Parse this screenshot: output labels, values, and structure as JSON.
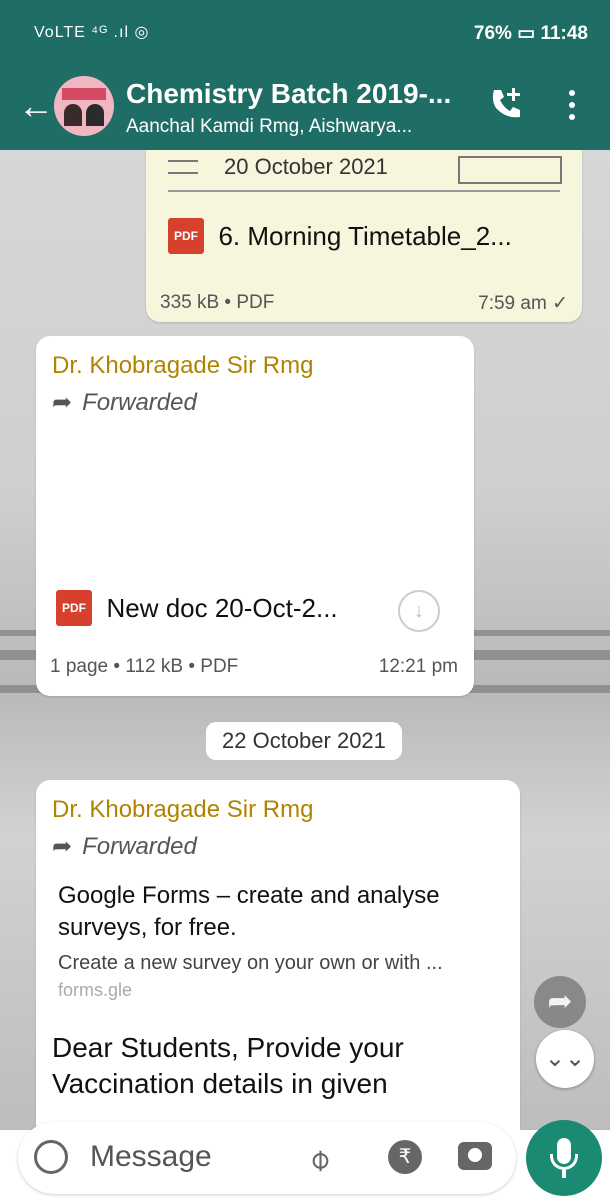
{
  "status_bar": {
    "left_icons": "VoLTE ⁴ᴳ .ıl ◎",
    "battery": "76%",
    "time": "11:48"
  },
  "header": {
    "title": "Chemistry Batch 2019-...",
    "subtitle": "Aanchal Kamdi Rmg, Aishwarya...",
    "brand_color": "#1f6e66"
  },
  "messages": [
    {
      "type": "document_out",
      "date_overlay": "20 October 2021",
      "file_name": "6. Morning Timetable_2...",
      "meta": "335 kB • PDF",
      "time": "7:59 am",
      "status": "✓"
    },
    {
      "type": "document_in",
      "sender": "Dr. Khobragade Sir Rmg",
      "forwarded": "Forwarded",
      "file_name": "New doc 20-Oct-2...",
      "meta": "1 page • 112 kB • PDF",
      "time": "12:21 pm"
    },
    {
      "type": "date_divider",
      "label": "22 October 2021"
    },
    {
      "type": "link_in",
      "sender": "Dr. Khobragade Sir Rmg",
      "forwarded": "Forwarded",
      "link_title": "Google Forms – create and analyse surveys, for free.",
      "link_desc": "Create a new survey on your own or with ...",
      "link_domain": "forms.gle",
      "body": "Dear Students, Provide your Vaccination details in given"
    }
  ],
  "input": {
    "placeholder": "Message"
  },
  "icons": {
    "pdf": "PDF"
  }
}
